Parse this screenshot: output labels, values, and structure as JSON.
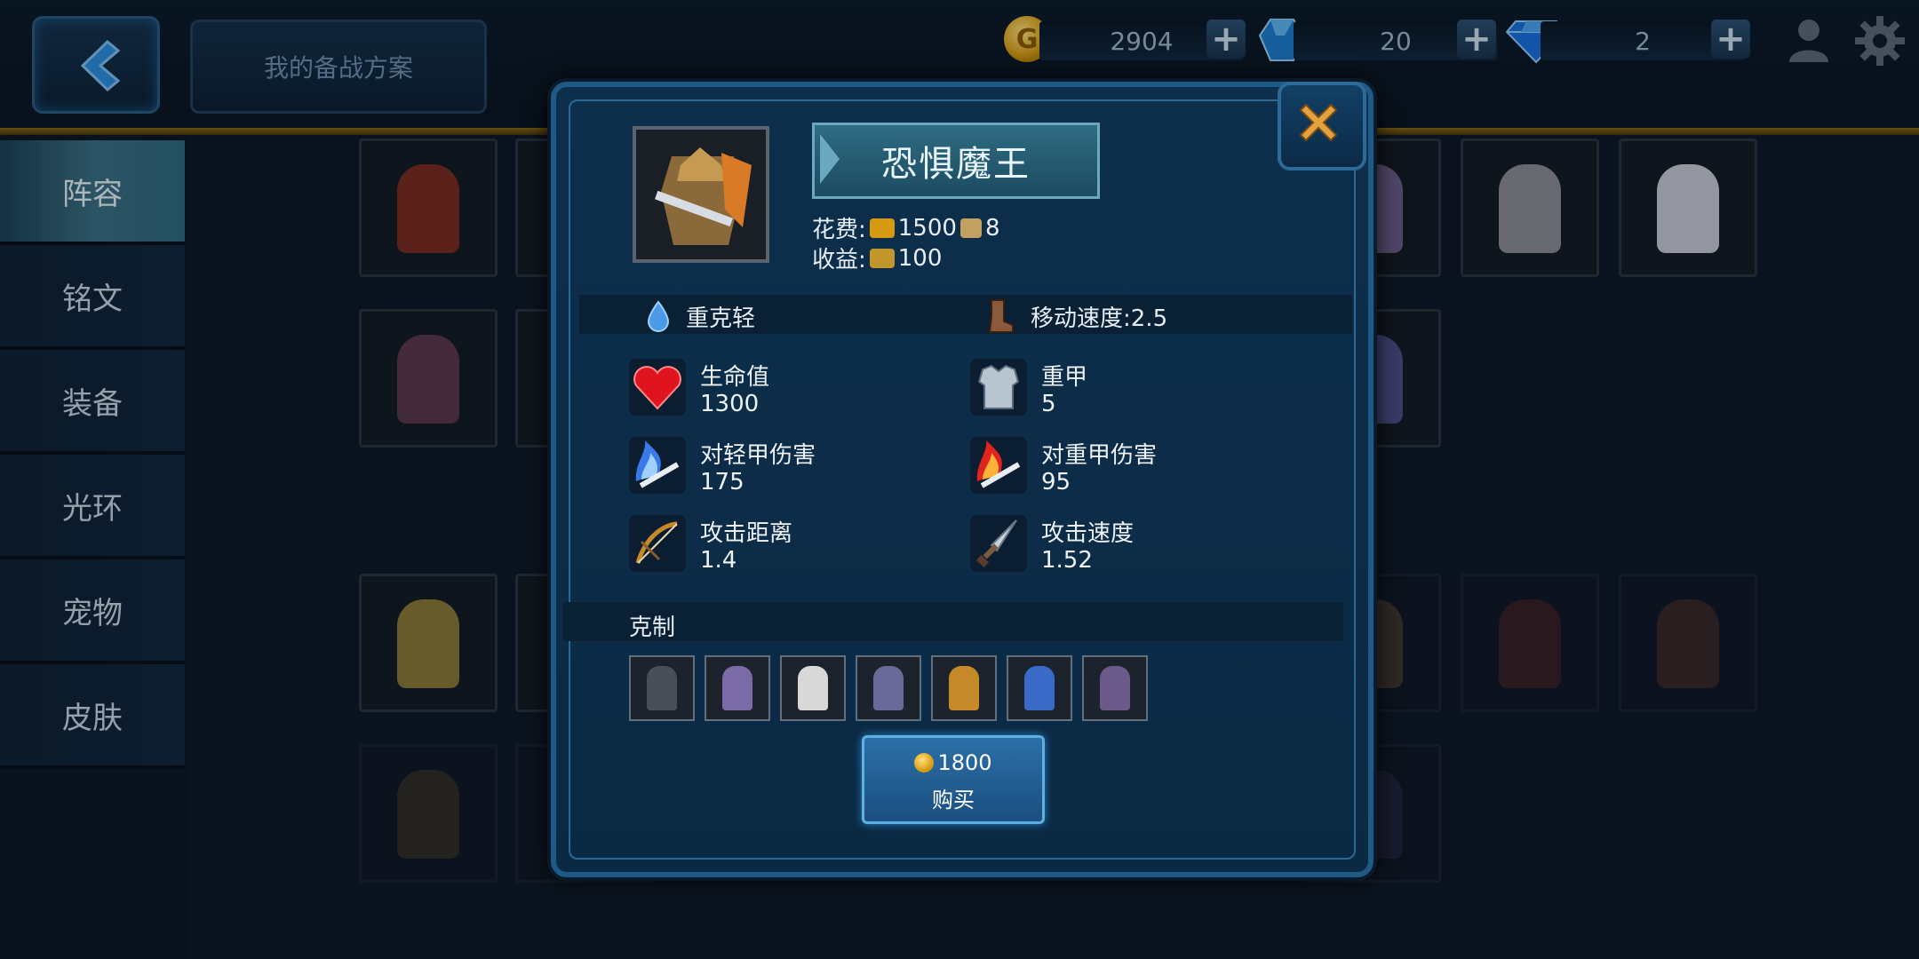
{
  "topbar": {
    "plan_button": "我的备战方案",
    "gold": "2904",
    "gems": "20",
    "diamonds": "2"
  },
  "sidebar": {
    "items": [
      {
        "label": "阵容"
      },
      {
        "label": "铭文"
      },
      {
        "label": "装备"
      },
      {
        "label": "光环"
      },
      {
        "label": "宠物"
      },
      {
        "label": "皮肤"
      }
    ]
  },
  "modal": {
    "name": "恐惧魔王",
    "cost_label": "花费:",
    "cost_gold": "1500",
    "cost_stars": "8",
    "income_label": "收益:",
    "income_value": "100",
    "counter_type": "重克轻",
    "move_speed": "移动速度:2.5",
    "stats": [
      {
        "label": "生命值",
        "value": "1300",
        "icon": "heart-icon"
      },
      {
        "label": "重甲",
        "value": "5",
        "icon": "armor-icon"
      },
      {
        "label": "对轻甲伤害",
        "value": "175",
        "icon": "blue-flame-sword-icon"
      },
      {
        "label": "对重甲伤害",
        "value": "95",
        "icon": "red-flame-sword-icon"
      },
      {
        "label": "攻击距离",
        "value": "1.4",
        "icon": "bow-icon"
      },
      {
        "label": "攻击速度",
        "value": "1.52",
        "icon": "dagger-icon"
      }
    ],
    "counters_label": "克制",
    "buy_price": "1800",
    "buy_label": "购买"
  },
  "colors": {
    "accent": "#2c6fa8",
    "gold": "#d59a12",
    "panel": "#0b2943"
  }
}
